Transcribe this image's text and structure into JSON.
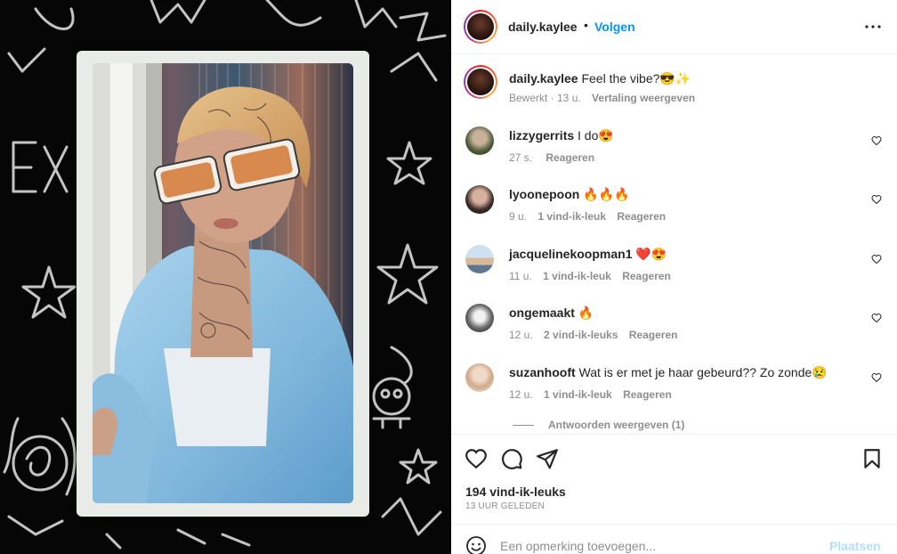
{
  "post": {
    "username": "daily.kaylee",
    "separator": "•",
    "follow_label": "Volgen",
    "more_label": "•••"
  },
  "caption": {
    "username": "daily.kaylee",
    "text": "Feel the vibe?😎✨",
    "edited": "Bewerkt · 13 u.",
    "translate_label": "Vertaling weergeven"
  },
  "comments": [
    {
      "username": "lizzygerrits",
      "text": "I do😍",
      "time": "27 s.",
      "likes": "",
      "reply_label": "Reageren"
    },
    {
      "username": "lyoonepoon",
      "text": "🔥🔥🔥",
      "time": "9 u.",
      "likes": "1 vind-ik-leuk",
      "reply_label": "Reageren"
    },
    {
      "username": "jacquelinekoopman1",
      "text": "❤️😍",
      "time": "11 u.",
      "likes": "1 vind-ik-leuk",
      "reply_label": "Reageren"
    },
    {
      "username": "ongemaakt",
      "text": "🔥",
      "time": "12 u.",
      "likes": "2 vind-ik-leuks",
      "reply_label": "Reageren"
    },
    {
      "username": "suzanhooft",
      "text": "Wat is er met je haar gebeurd?? Zo zonde😢",
      "time": "12 u.",
      "likes": "1 vind-ik-leuk",
      "reply_label": "Reageren"
    }
  ],
  "view_replies_label": "Antwoorden weergeven (1)",
  "likes_count": "194 vind-ik-leuks",
  "time_ago": "13 UUR GELEDEN",
  "composer": {
    "placeholder": "Een opmerking toevoegen...",
    "post_label": "Plaatsen"
  },
  "colors": {
    "link_blue": "#0095f6",
    "post_disabled": "#b2dffc",
    "secondary_text": "#8e8e8e"
  }
}
